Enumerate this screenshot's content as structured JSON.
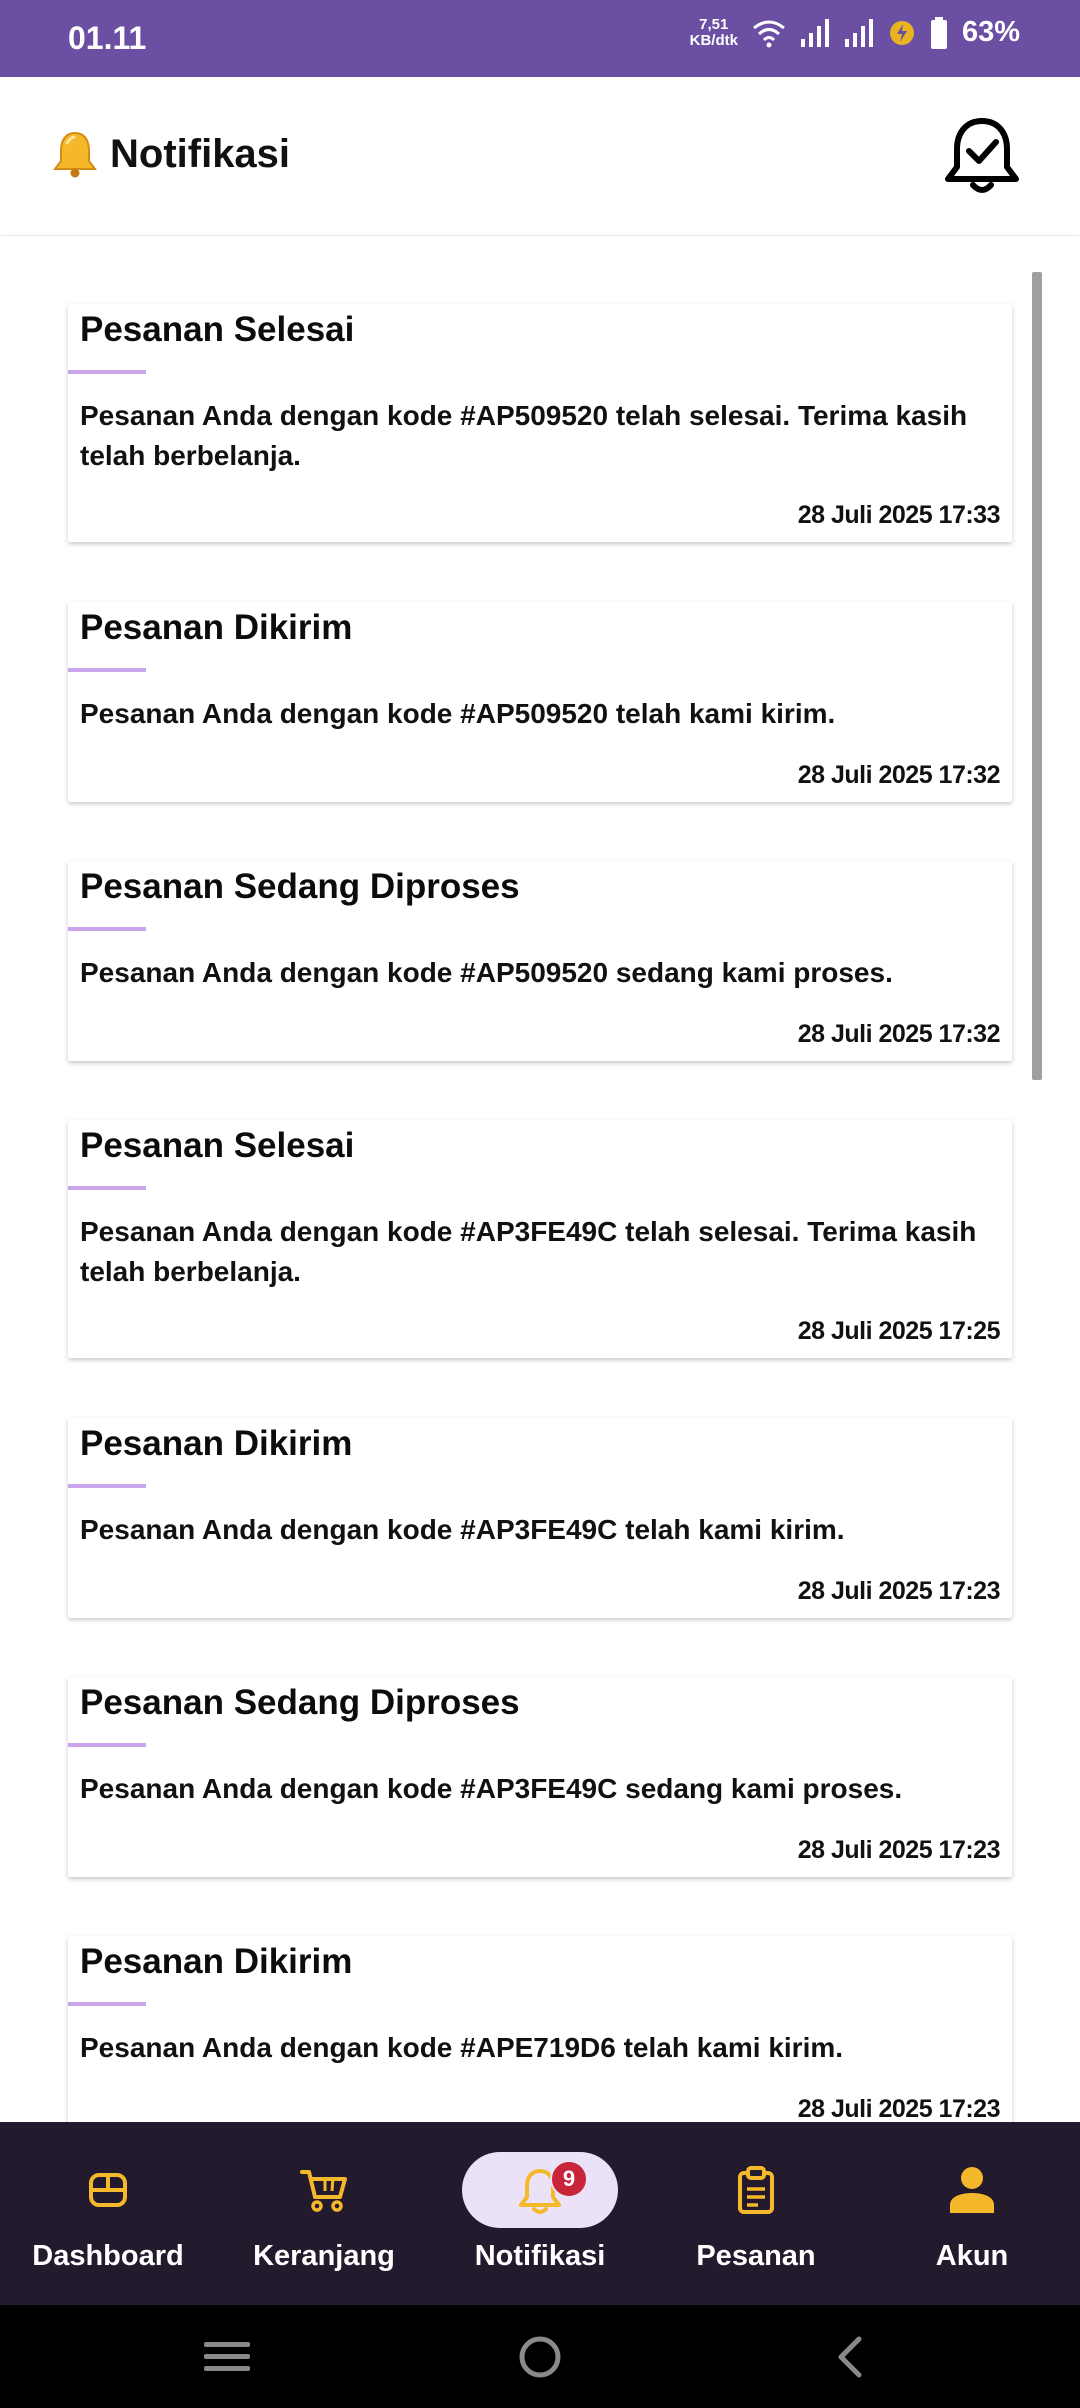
{
  "status_bar": {
    "time": "01.11",
    "net_speed_value": "7,51",
    "net_speed_unit": "KB/dtk",
    "battery": "63%"
  },
  "header": {
    "title": "Notifikasi",
    "bell_icon": "bell-check-icon"
  },
  "notifications": [
    {
      "title": "Pesanan Selesai",
      "body": "Pesanan Anda dengan kode #AP509520 telah selesai. Terima kasih telah berbelanja.",
      "date": "28 Juli 2025 17:33"
    },
    {
      "title": "Pesanan Dikirim",
      "body": "Pesanan Anda dengan kode #AP509520 telah kami kirim.",
      "date": "28 Juli 2025 17:32"
    },
    {
      "title": "Pesanan Sedang Diproses",
      "body": "Pesanan Anda dengan kode #AP509520 sedang kami proses.",
      "date": "28 Juli 2025 17:32"
    },
    {
      "title": "Pesanan Selesai",
      "body": "Pesanan Anda dengan kode #AP3FE49C telah selesai. Terima kasih telah berbelanja.",
      "date": "28 Juli 2025 17:25"
    },
    {
      "title": "Pesanan Dikirim",
      "body": "Pesanan Anda dengan kode #AP3FE49C telah kami kirim.",
      "date": "28 Juli 2025 17:23"
    },
    {
      "title": "Pesanan Sedang Diproses",
      "body": "Pesanan Anda dengan kode #AP3FE49C sedang kami proses.",
      "date": "28 Juli 2025 17:23"
    },
    {
      "title": "Pesanan Dikirim",
      "body": "Pesanan Anda dengan kode #APE719D6 telah kami kirim.",
      "date": "28 Juli 2025 17:23"
    }
  ],
  "bottom_nav": {
    "items": [
      {
        "label": "Dashboard",
        "icon": "dashboard-icon"
      },
      {
        "label": "Keranjang",
        "icon": "cart-icon"
      },
      {
        "label": "Notifikasi",
        "icon": "bell-icon",
        "badge": "9",
        "active": true
      },
      {
        "label": "Pesanan",
        "icon": "clipboard-icon"
      },
      {
        "label": "Akun",
        "icon": "person-icon"
      }
    ]
  },
  "colors": {
    "status_bar": "#6a4fa3",
    "nav_background": "#241a2e",
    "nav_icon": "#f5b82a",
    "accent_line": "#c9a6ec",
    "badge": "#c8243a"
  }
}
